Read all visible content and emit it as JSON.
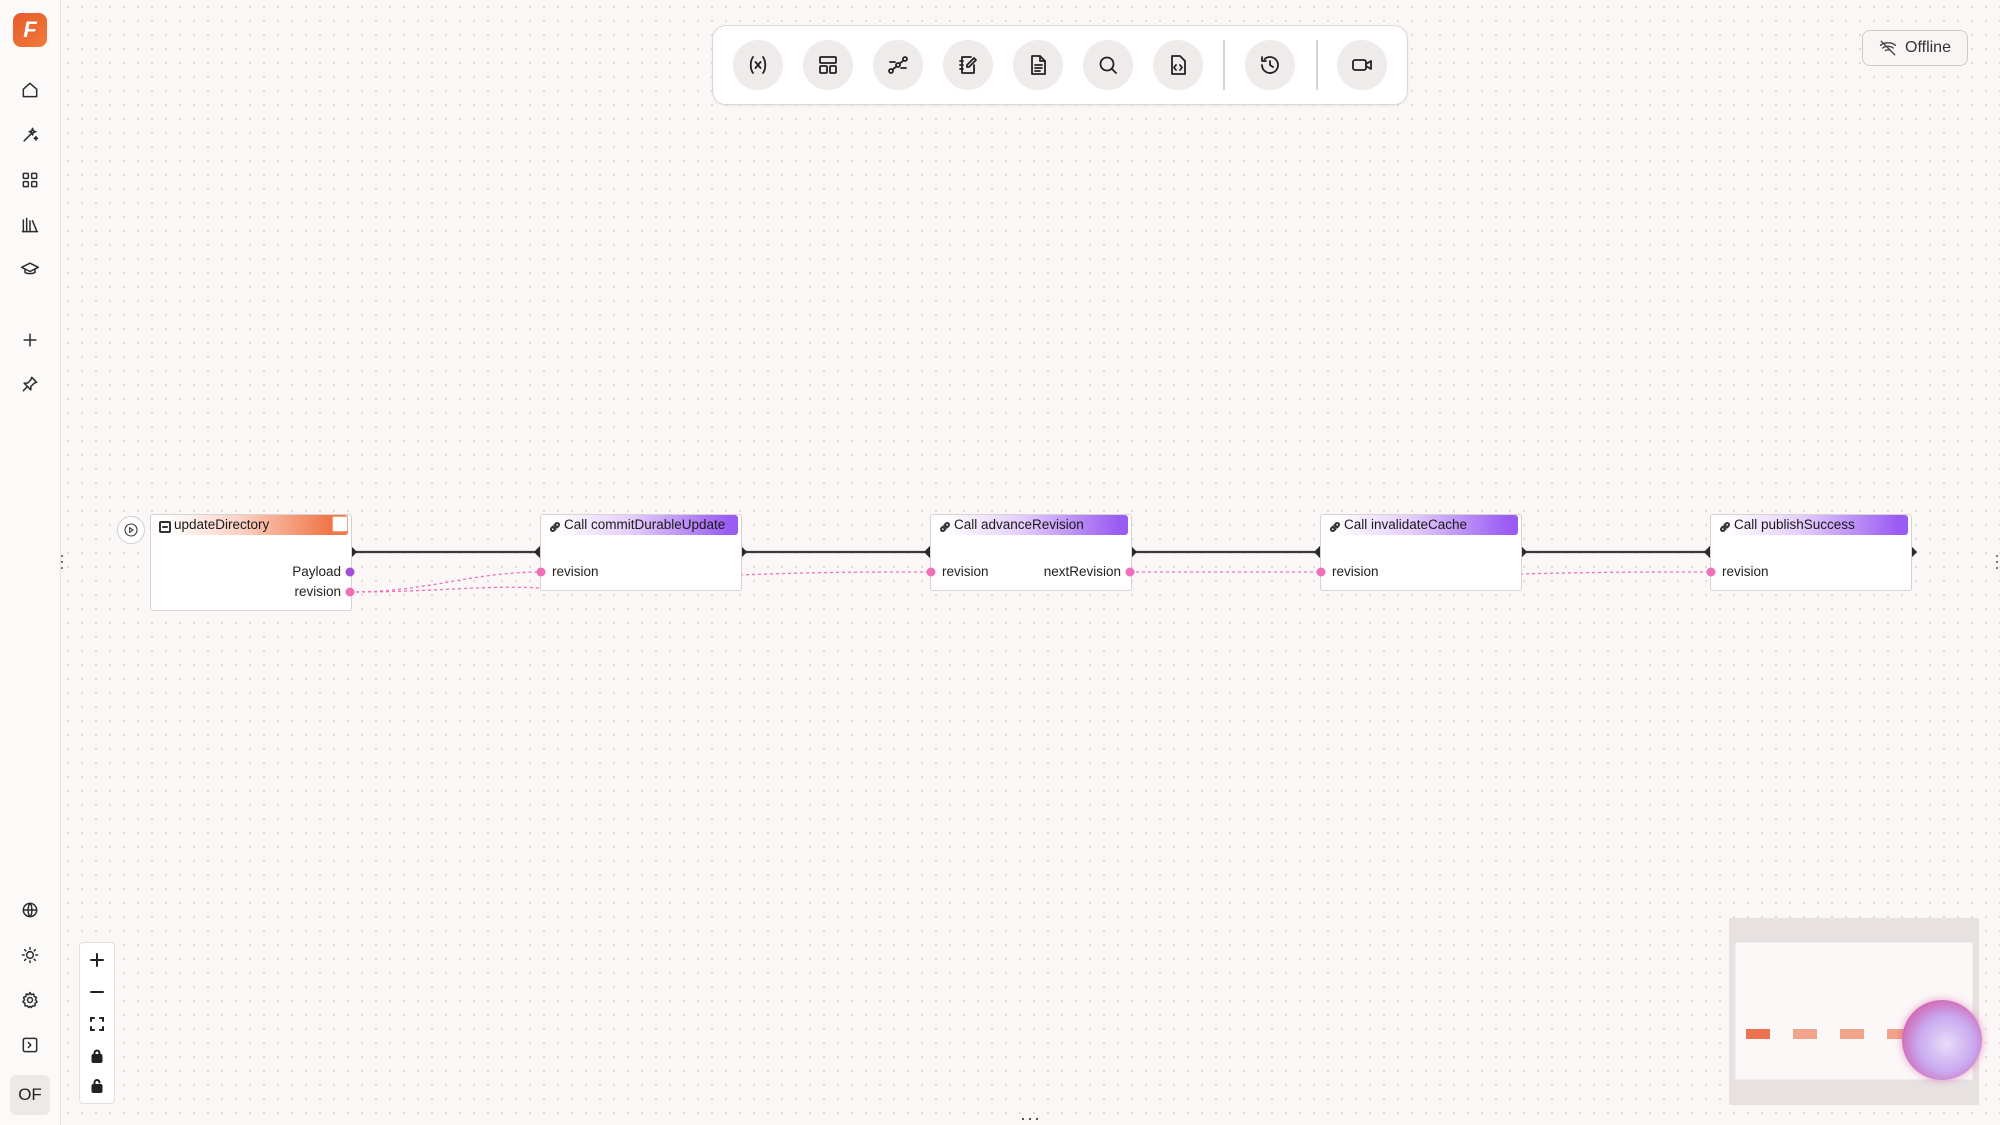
{
  "sidebar": {
    "logo_glyph": "F",
    "top_icons": [
      "home-icon",
      "sparkle-wand-icon",
      "grid-icon",
      "library-icon",
      "graduation-cap-icon"
    ],
    "action_icons": [
      "plus-icon",
      "pin-icon"
    ],
    "bottom_icons": [
      "globe-icon",
      "sun-icon",
      "gear-icon",
      "panel-toggle-icon"
    ],
    "avatar_initials": "OF"
  },
  "toolbar": {
    "buttons": [
      "variable-icon",
      "layout-icon",
      "flow-icon",
      "edit-note-icon",
      "document-icon",
      "search-icon",
      "code-file-icon",
      "history-icon",
      "video-icon"
    ]
  },
  "status": {
    "label": "Offline"
  },
  "nodes": [
    {
      "title": "updateDirectory",
      "outputs": [
        "Payload",
        "revision"
      ]
    },
    {
      "title": "Call commitDurableUpdate",
      "inputs": [
        "revision"
      ]
    },
    {
      "title": "Call advanceRevision",
      "inputs": [
        "revision"
      ],
      "outputs": [
        "nextRevision"
      ]
    },
    {
      "title": "Call invalidateCache",
      "inputs": [
        "revision"
      ]
    },
    {
      "title": "Call publishSuccess",
      "inputs": [
        "revision"
      ]
    }
  ],
  "colors": {
    "accent_orange": "#f07748",
    "accent_purple": "#9a5cf3",
    "data_port_pink": "#f06fb8",
    "payload_port_purple": "#a34fd6",
    "exec_edge": "#3a3a3a"
  },
  "zoom_controls": [
    "zoom-in-icon",
    "zoom-out-icon",
    "fit-view-icon",
    "lock-icon",
    "unlock-icon"
  ]
}
